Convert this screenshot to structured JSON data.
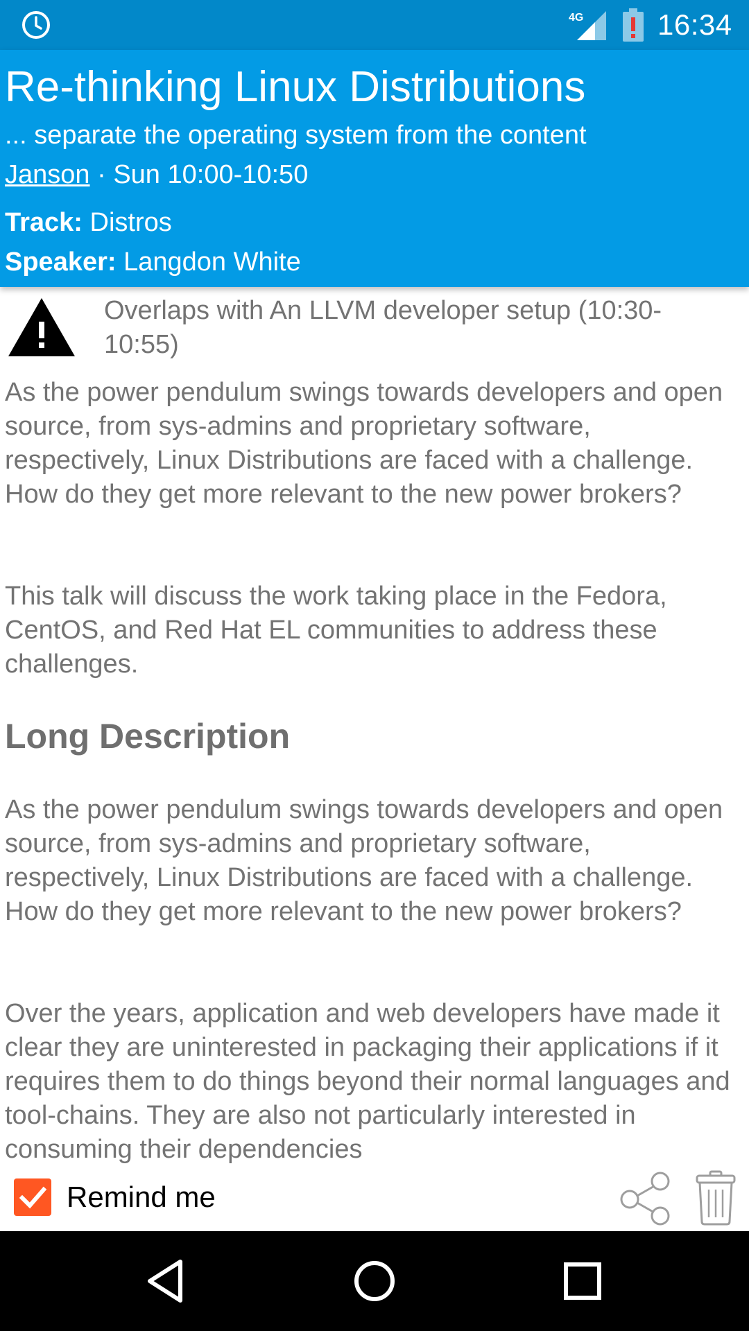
{
  "status_bar": {
    "time": "16:34",
    "network": "4G",
    "icons": [
      "alarm-icon",
      "signal-icon",
      "battery-alert-icon"
    ],
    "battery_alert_color": "#e53935"
  },
  "event": {
    "title": "Re-thinking Linux Distributions",
    "subtitle": "... separate the operating system from the content",
    "room": "Janson",
    "time_text": " · Sun 10:00-10:50",
    "track_label": "Track:",
    "track_value": " Distros",
    "speaker_label": "Speaker:",
    "speaker_value": " Langdon White"
  },
  "warning": {
    "icon": "warning-icon",
    "text": "Overlaps with An LLVM developer setup (10:30-10:55)"
  },
  "abstract": {
    "paragraphs": [
      "As the power pendulum swings towards developers and open source, from sys-admins and proprietary software, respectively, Linux Distributions are faced with a challenge. How do they get more relevant to the new power brokers?",
      "This talk will discuss the work taking place in the Fedora, CentOS, and Red Hat EL communities to address these challenges."
    ]
  },
  "long_description": {
    "heading": "Long Description",
    "paragraphs": [
      "As the power pendulum swings towards developers and open source, from sys-admins and proprietary software, respectively, Linux Distributions are faced with a challenge. How do they get more relevant to the new power brokers?",
      "Over the years, application and web developers have made it clear they are uninterested in packaging their applications if it requires them to do things beyond their normal languages and tool-chains. They are also not particularly interested in consuming their dependencies"
    ]
  },
  "actions": {
    "remind_label": "Remind me",
    "remind_checked": true,
    "checkbox_color": "#ff5722",
    "share_icon": "share-icon",
    "delete_icon": "trash-icon"
  },
  "nav": {
    "icons": [
      "back-icon",
      "home-icon",
      "recents-icon"
    ]
  },
  "colors": {
    "status_bar": "#0288c9",
    "header": "#039be5",
    "body_text": "#737373"
  }
}
